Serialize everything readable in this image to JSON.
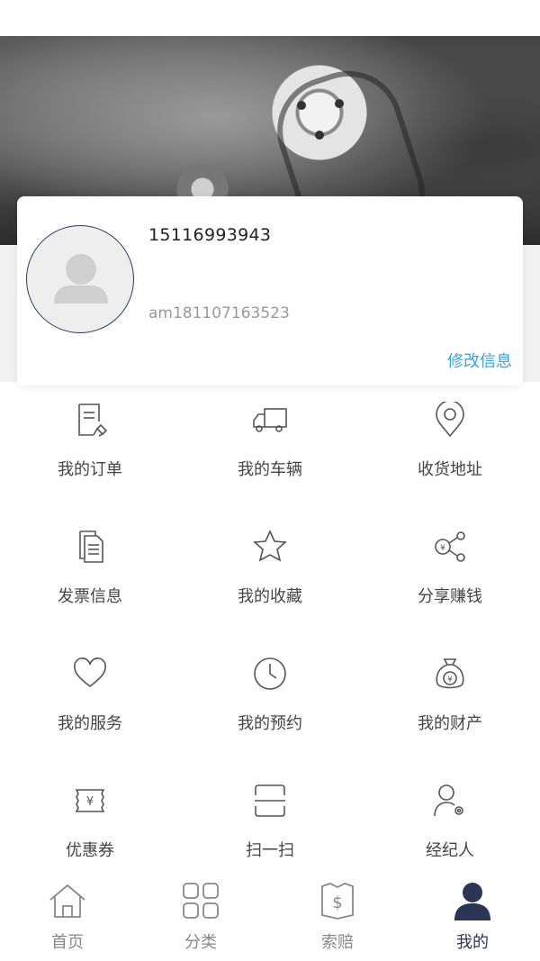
{
  "profile": {
    "phone": "15116993943",
    "account": "am181107163523",
    "edit_label": "修改信息"
  },
  "menu": [
    [
      {
        "name": "my-orders",
        "icon": "order-doc-icon",
        "label": "我的订单"
      },
      {
        "name": "my-vehicles",
        "icon": "truck-icon",
        "label": "我的车辆"
      },
      {
        "name": "shipping-address",
        "icon": "location-pin-icon",
        "label": "收货地址"
      }
    ],
    [
      {
        "name": "invoice-info",
        "icon": "invoice-doc-icon",
        "label": "发票信息"
      },
      {
        "name": "my-favorites",
        "icon": "star-icon",
        "label": "我的收藏"
      },
      {
        "name": "share-earn",
        "icon": "share-yen-icon",
        "label": "分享赚钱"
      }
    ],
    [
      {
        "name": "my-services",
        "icon": "heart-icon",
        "label": "我的服务"
      },
      {
        "name": "my-appointments",
        "icon": "clock-icon",
        "label": "我的预约"
      },
      {
        "name": "my-assets",
        "icon": "money-bag-icon",
        "label": "我的财产"
      }
    ],
    [
      {
        "name": "coupons",
        "icon": "coupon-yen-icon",
        "label": "优惠券"
      },
      {
        "name": "scan",
        "icon": "scan-icon",
        "label": "扫一扫"
      },
      {
        "name": "agent",
        "icon": "agent-user-icon",
        "label": "经纪人"
      }
    ]
  ],
  "tabbar": [
    {
      "name": "home",
      "icon": "home-icon",
      "label": "首页",
      "active": false
    },
    {
      "name": "category",
      "icon": "grid-icon",
      "label": "分类",
      "active": false
    },
    {
      "name": "claims",
      "icon": "claim-dollar-icon",
      "label": "索赔",
      "active": false
    },
    {
      "name": "mine",
      "icon": "person-icon",
      "label": "我的",
      "active": true
    }
  ],
  "colors": {
    "accent_link": "#3aa3d8",
    "active_tab": "#2b3555",
    "icon_stroke": "#555555"
  }
}
